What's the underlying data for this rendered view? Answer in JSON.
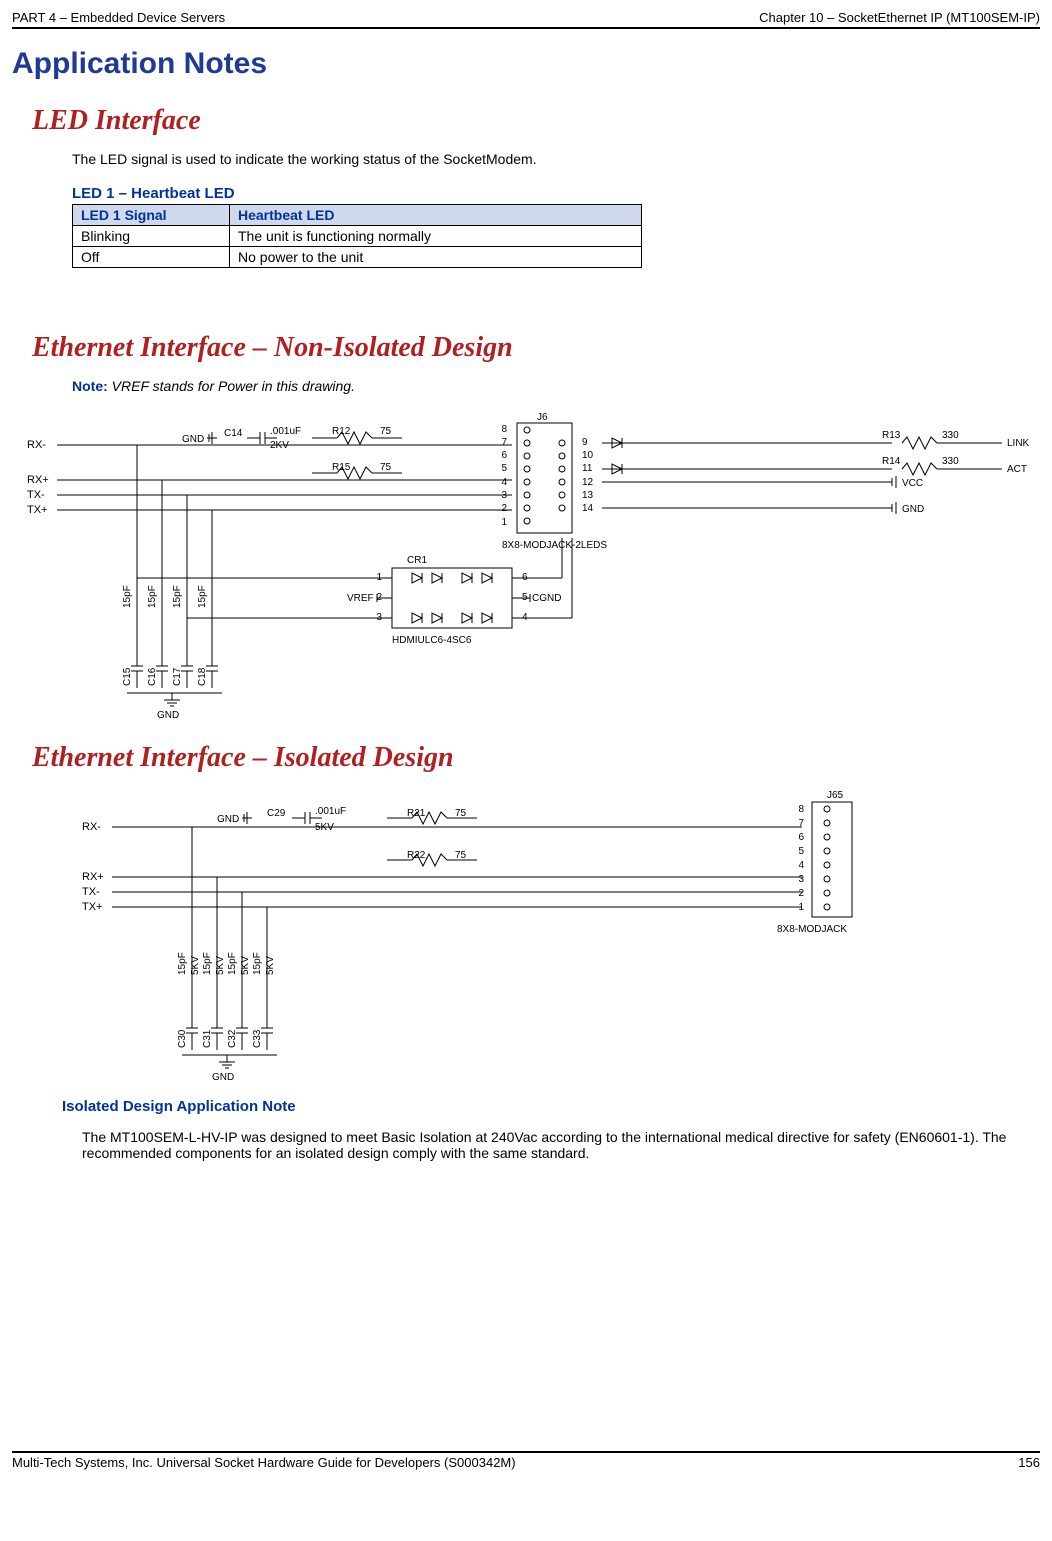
{
  "header": {
    "left": "PART 4 – Embedded Device Servers",
    "right": "Chapter 10 – SocketEthernet IP (MT100SEM-IP)"
  },
  "title": "Application Notes",
  "led": {
    "section": "LED Interface",
    "intro": "The LED signal is used to indicate the working status of the SocketModem.",
    "table_title": "LED 1 – Heartbeat LED",
    "th1": "LED 1 Signal",
    "th2": "Heartbeat LED",
    "r1c1": "Blinking",
    "r1c2": "The unit is functioning normally",
    "r2c1": "Off",
    "r2c2": "No power to the unit"
  },
  "eth_noniso": {
    "section": "Ethernet Interface – Non-Isolated Design",
    "note_label": "Note:",
    "note_text": " VREF stands for Power in this drawing."
  },
  "eth_iso": {
    "section": "Ethernet Interface – Isolated Design",
    "app_note_title": "Isolated Design Application Note",
    "app_note_body": "The MT100SEM-L-HV-IP was designed to meet Basic Isolation at 240Vac according to the international medical directive for safety (EN60601-1). The recommended components for an isolated design comply with the same standard."
  },
  "diagram1": {
    "rx_minus": "RX-",
    "rx_plus": "RX+",
    "tx_minus": "TX-",
    "tx_plus": "TX+",
    "gnd": "GND",
    "c14": "C14",
    "c14v": ".001uF",
    "c14r": "2KV",
    "r12": "R12",
    "r12v": "75",
    "r15": "R15",
    "r15v": "75",
    "j6": "J6",
    "conn": "8X8-MODJACK-2LEDS",
    "r13": "R13",
    "r13v": "330",
    "link": "LINK",
    "r14": "R14",
    "r14v": "330",
    "act": "ACT",
    "vcc": "VCC",
    "gnd2": "GND",
    "cr1": "CR1",
    "vref": "VREF",
    "cgnd": "CGND",
    "hdmi": "HDMIULC6-4SC6",
    "caps": {
      "v": "15pF",
      "c15": "C15",
      "c16": "C16",
      "c17": "C17",
      "c18": "C18"
    },
    "pins": {
      "p1": "1",
      "p2": "2",
      "p3": "3",
      "p4": "4",
      "p5": "5",
      "p6": "6",
      "p7": "7",
      "p8": "8",
      "p9": "9",
      "p10": "10",
      "p11": "11",
      "p12": "12",
      "p13": "13",
      "p14": "14"
    }
  },
  "diagram2": {
    "rx_minus": "RX-",
    "rx_plus": "RX+",
    "tx_minus": "TX-",
    "tx_plus": "TX+",
    "gnd": "GND",
    "c29": "C29",
    "c29v": ".001uF",
    "c29r": "5KV",
    "r21": "R21",
    "r21v": "75",
    "r22": "R22",
    "r22v": "75",
    "j65": "J65",
    "conn": "8X8-MODJACK",
    "caps": {
      "v": "15pF",
      "r": "5KV",
      "c30": "C30",
      "c31": "C31",
      "c32": "C32",
      "c33": "C33"
    },
    "pins": {
      "p1": "1",
      "p2": "2",
      "p3": "3",
      "p4": "4",
      "p5": "5",
      "p6": "6",
      "p7": "7",
      "p8": "8"
    },
    "gnd2": "GND"
  },
  "footer": {
    "left": "Multi-Tech Systems, Inc. Universal Socket Hardware Guide for Developers (S000342M)",
    "right": "156"
  }
}
